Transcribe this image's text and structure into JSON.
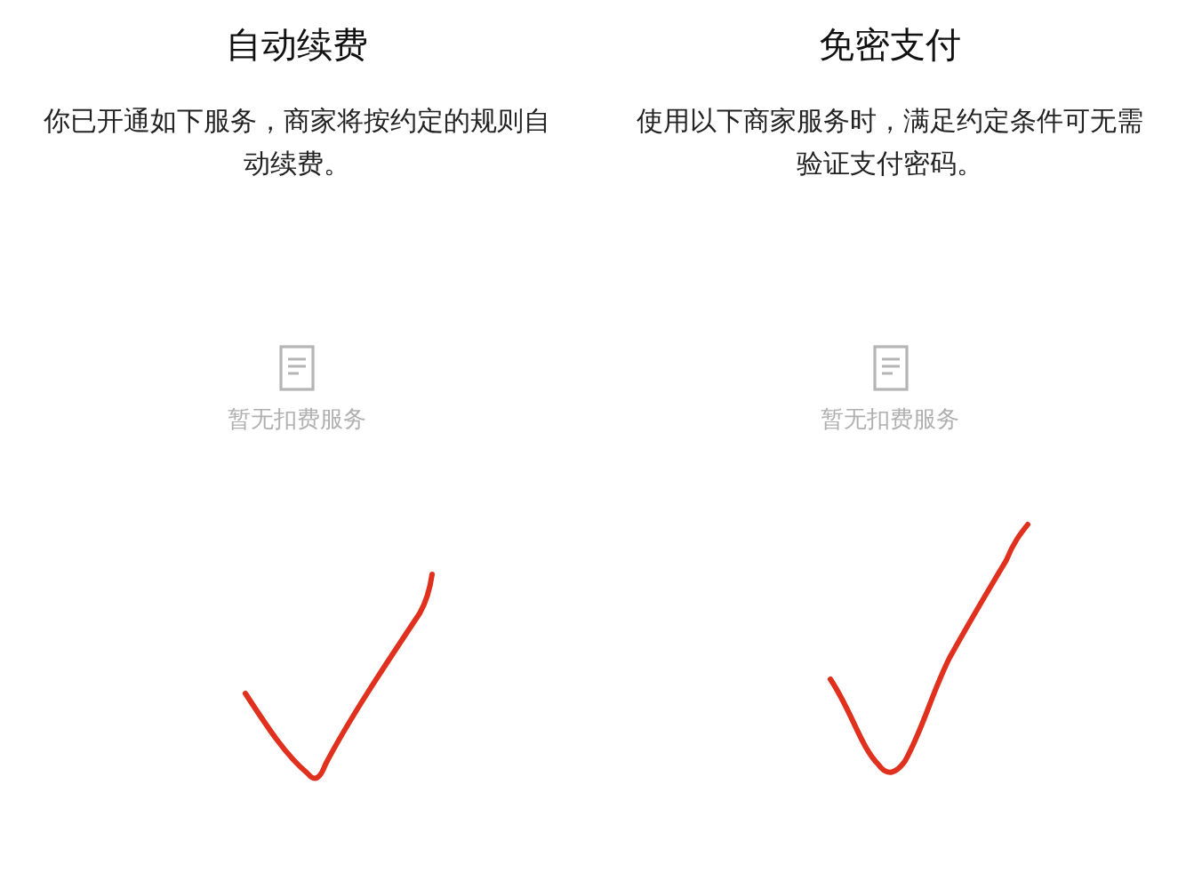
{
  "panels": [
    {
      "title": "自动续费",
      "description": "你已开通如下服务，商家将按约定的规则自动续费。",
      "empty_text": "暂无扣费服务"
    },
    {
      "title": "免密支付",
      "description": "使用以下商家服务时，满足约定条件可无需验证支付密码。",
      "empty_text": "暂无扣费服务"
    }
  ]
}
